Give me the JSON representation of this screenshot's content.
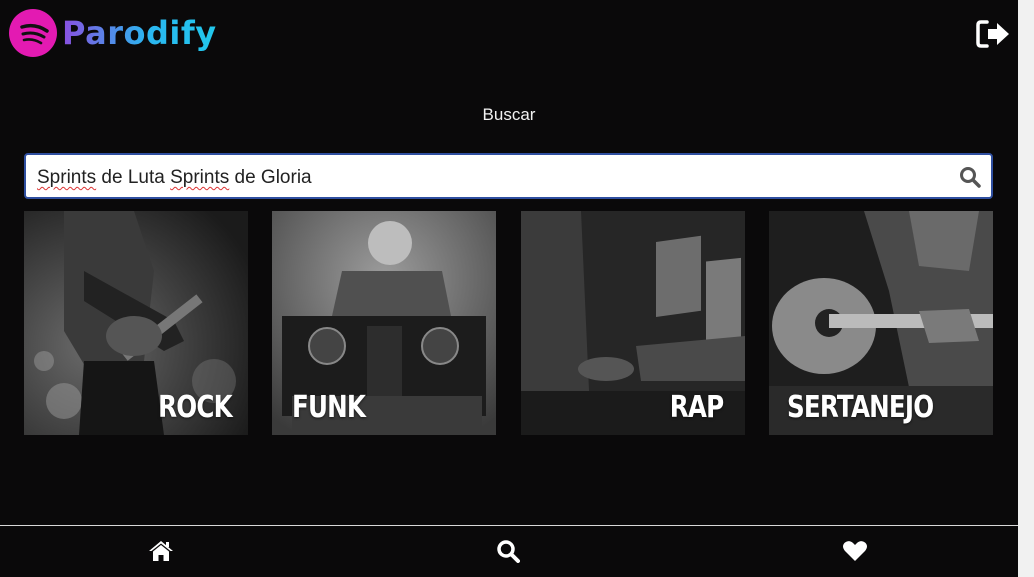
{
  "app": {
    "name": "Parodify",
    "colors": {
      "brand_pink": "#e31ab2",
      "brand_gradient_start": "#8a4fe0",
      "brand_gradient_end": "#21c8ec",
      "background": "#0a090a",
      "search_border": "#2f4fa0"
    }
  },
  "header": {
    "logo_icon": "spotify-like-waves-icon",
    "logout_icon": "sign-out-icon"
  },
  "search": {
    "label": "Buscar",
    "value": "Sprints de Luta Sprints de Gloria",
    "value_parts": [
      "Sprints",
      " de Luta ",
      "Sprints",
      " de Gloria"
    ],
    "icon": "search-icon"
  },
  "genres": [
    {
      "label": "ROCK",
      "image": "guitarist-bw"
    },
    {
      "label": "FUNK",
      "image": "dj-mixer-bw"
    },
    {
      "label": "RAP",
      "image": "laptop-dj-bw"
    },
    {
      "label": "SERTANEJO",
      "image": "acoustic-guitar-bw"
    }
  ],
  "bottom_nav": [
    {
      "icon": "home-icon"
    },
    {
      "icon": "search-icon"
    },
    {
      "icon": "heart-icon"
    }
  ]
}
